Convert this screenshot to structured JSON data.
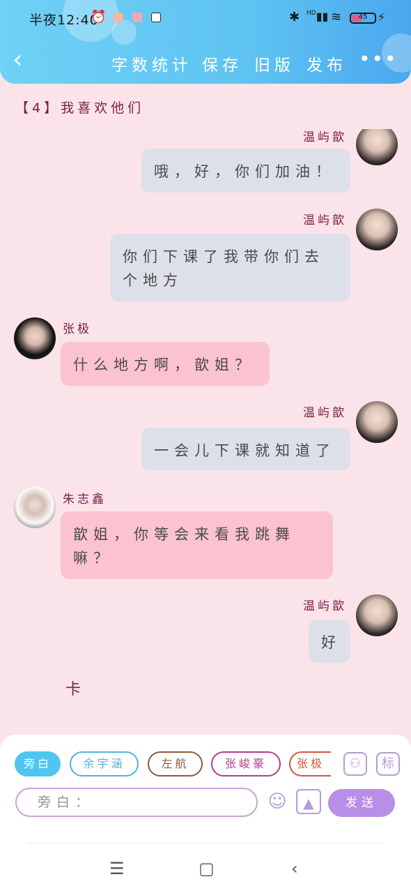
{
  "status_bar": {
    "time": "半夜12:40",
    "battery_text": "45",
    "battery_level": 0.45,
    "network": "HD"
  },
  "header": {
    "buttons": [
      "字数统计",
      "保存",
      "旧版",
      "发布"
    ],
    "more_label": "•••"
  },
  "chat": {
    "title": "【4】我喜欢他们",
    "messages": [
      {
        "side": "right",
        "name": "温屿歆",
        "text": "哦，好，你们加油！"
      },
      {
        "side": "right",
        "name": "温屿歆",
        "text": "你们下课了我带你们去个地方"
      },
      {
        "side": "left",
        "name": "张极",
        "text": "什么地方啊，歆姐？"
      },
      {
        "side": "right",
        "name": "温屿歆",
        "text": "一会儿下课就知道了"
      },
      {
        "side": "left",
        "name": "朱志鑫",
        "text": "歆姐，你等会来看我跳舞嘛？"
      },
      {
        "side": "right",
        "name": "温屿歆",
        "text": "好"
      }
    ],
    "loose_text": "卡"
  },
  "composer": {
    "chips": [
      "旁白",
      "余宇涵",
      "左航",
      "张峻豪",
      "张极"
    ],
    "chip_colors": [
      "#4fc6f0",
      "#4fb4d8",
      "#8b5a3c",
      "#b23c8e",
      "#d2563c"
    ],
    "tag_label": "标",
    "input_placeholder": "旁白：",
    "send_label": "发送"
  },
  "colors": {
    "header_start": "#6fd1f6",
    "header_end": "#4aa8ee",
    "background": "#fbe3ea",
    "bubble_right": "#dde0e8",
    "bubble_left": "#fbc2cf",
    "name": "#7a1f4a",
    "send": "#b88ee6"
  }
}
